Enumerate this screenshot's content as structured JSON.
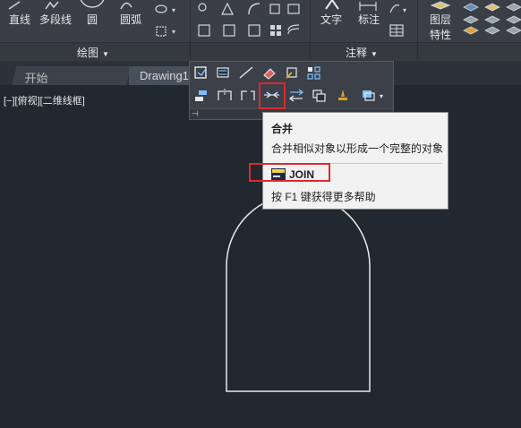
{
  "ribbon": {
    "draw_panel": {
      "title": "绘图",
      "tools": [
        {
          "label": "直线",
          "icon": "line-tool-icon"
        },
        {
          "label": "多段线",
          "icon": "polyline-tool-icon"
        },
        {
          "label": "圆",
          "icon": "circle-tool-icon"
        },
        {
          "label": "圆弧",
          "icon": "arc-tool-icon"
        }
      ]
    },
    "annotation_panel": {
      "title": "注释",
      "tools": [
        {
          "label": "文字",
          "icon": "text-tool-icon"
        },
        {
          "label": "标注",
          "icon": "dimension-tool-icon"
        }
      ]
    },
    "layers_panel": {
      "label_line1": "图层",
      "label_line2": "特性",
      "icon": "layer-properties-icon"
    }
  },
  "tabs": {
    "start": "开始",
    "drawing": "Drawing1"
  },
  "viewport": {
    "label": "[−][俯视][二维线框]"
  },
  "tooltip": {
    "title": "合并",
    "description": "合并相似对象以形成一个完整的对象",
    "command": "JOIN",
    "help": "按 F1 键获得更多帮助"
  },
  "colors": {
    "background": "#212830",
    "ribbon": "#3a3f47",
    "highlight": "#e0282e",
    "tooltip_bg": "#f2f2f2",
    "drawing_line": "#e8e8e8"
  }
}
